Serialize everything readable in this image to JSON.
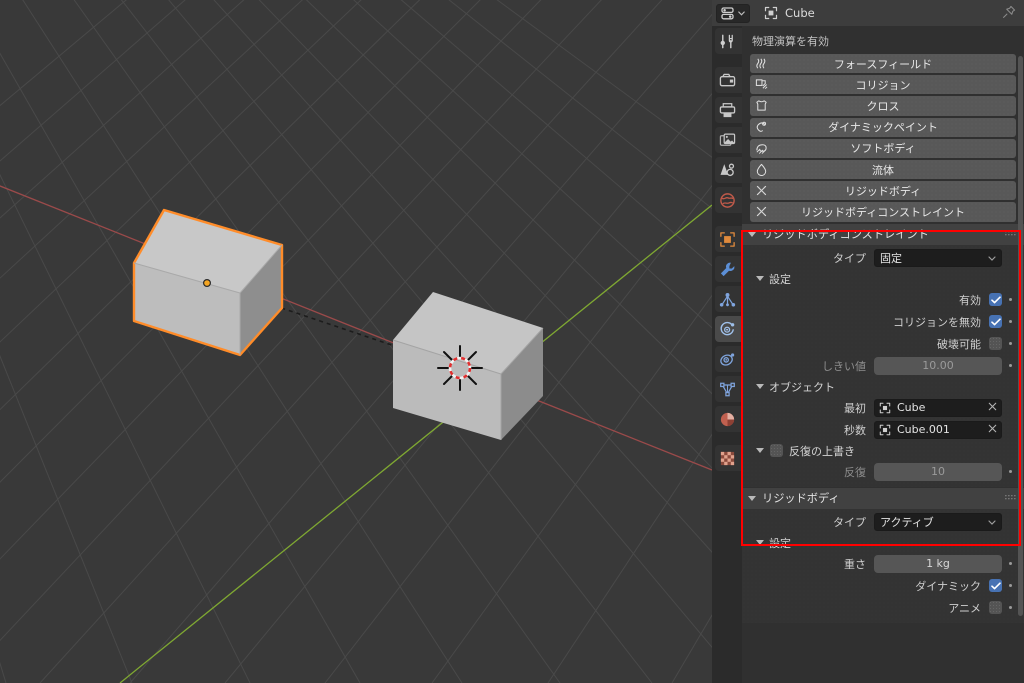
{
  "app": "Blender",
  "viewport": {
    "name": "3d-viewport",
    "background_color": "#393939",
    "grid_color": "#4b4b4b",
    "x_axis_color": "#9e4b4b",
    "y_axis_color": "#7fa832",
    "objects": [
      {
        "name": "Cube",
        "selected": true,
        "outline_color": "#ff8c29",
        "origin_color": "#f5a623"
      },
      {
        "name": "Cube.001",
        "selected": false,
        "outline_color": "none"
      }
    ],
    "constraint_line": "dashed-relationship-line",
    "cursor": "3d-cursor"
  },
  "properties_editor": {
    "header": {
      "editor_type": "properties-editor",
      "id_icon": "object-data-icon",
      "id_name": "Cube",
      "pin_label": "pin-id"
    },
    "tabs": [
      {
        "name": "tool",
        "icon": "tool-icon",
        "color": "#cfcfcf"
      },
      {
        "name": "render",
        "icon": "camera-back-icon",
        "color": "#c8c8c8"
      },
      {
        "name": "output",
        "icon": "printer-icon",
        "color": "#c8c8c8"
      },
      {
        "name": "view-layer",
        "icon": "images-icon",
        "color": "#c8c8c8"
      },
      {
        "name": "scene",
        "icon": "scene-cone-icon",
        "color": "#c8c8c8"
      },
      {
        "name": "world",
        "icon": "world-globe-icon",
        "color": "#c05a4a"
      },
      {
        "name": "object",
        "icon": "object-square-icon",
        "color": "#e08a3c"
      },
      {
        "name": "modifiers",
        "icon": "wrench-icon",
        "color": "#5c8fd6"
      },
      {
        "name": "particles",
        "icon": "particles-icon",
        "color": "#7fa4dd"
      },
      {
        "name": "physics",
        "icon": "physics-orbit-icon",
        "color": "#7fa4dd",
        "active": true
      },
      {
        "name": "object-constraints",
        "icon": "constraint-icon",
        "color": "#7fa4dd"
      },
      {
        "name": "object-data",
        "icon": "mesh-data-triangle-icon",
        "color": "#7fa4dd"
      },
      {
        "name": "material",
        "icon": "material-sphere-icon",
        "color": "#c0604f"
      },
      {
        "name": "texture",
        "icon": "texture-checker-icon",
        "color": "#c4705c"
      }
    ],
    "enable_physics_label": "物理演算を有効",
    "physics_buttons": [
      {
        "label": "フォースフィールド",
        "icon": "force-field-icon",
        "enabled": false
      },
      {
        "label": "コリジョン",
        "icon": "collision-icon",
        "enabled": false
      },
      {
        "label": "クロス",
        "icon": "cloth-icon",
        "enabled": false
      },
      {
        "label": "ダイナミックペイント",
        "icon": "dynamic-paint-icon",
        "enabled": false
      },
      {
        "label": "ソフトボディ",
        "icon": "soft-body-icon",
        "enabled": false
      },
      {
        "label": "流体",
        "icon": "fluid-icon",
        "enabled": false
      },
      {
        "label": "リジッドボディ",
        "icon": "x-icon",
        "enabled": true
      },
      {
        "label": "リジッドボディコンストレイント",
        "icon": "x-icon",
        "enabled": true
      }
    ],
    "rbc_panel": {
      "title": "リジッドボディコンストレイント",
      "type_label": "タイプ",
      "type_value": "固定",
      "settings_label": "設定",
      "enabled_label": "有効",
      "enabled_checked": true,
      "disable_collisions_label": "コリジョンを無効",
      "disable_collisions_checked": true,
      "breakable_label": "破壊可能",
      "breakable_checked": false,
      "threshold_label": "しきい値",
      "threshold_value": "10.00",
      "objects_label": "オブジェクト",
      "first_label": "最初",
      "first_value": "Cube",
      "second_label": "秒数",
      "second_value": "Cube.001",
      "override_iterations_label": "反復の上書き",
      "override_iterations_checked": false,
      "iterations_label": "反復",
      "iterations_value": "10"
    },
    "rb_panel": {
      "title": "リジッドボディ",
      "type_label": "タイプ",
      "type_value": "アクティブ",
      "settings_label": "設定",
      "mass_label": "重さ",
      "mass_value": "1 kg",
      "dynamic_label": "ダイナミック",
      "dynamic_checked": true,
      "animated_label": "アニメ",
      "animated_checked": false
    },
    "highlight_color": "#ff0000"
  }
}
